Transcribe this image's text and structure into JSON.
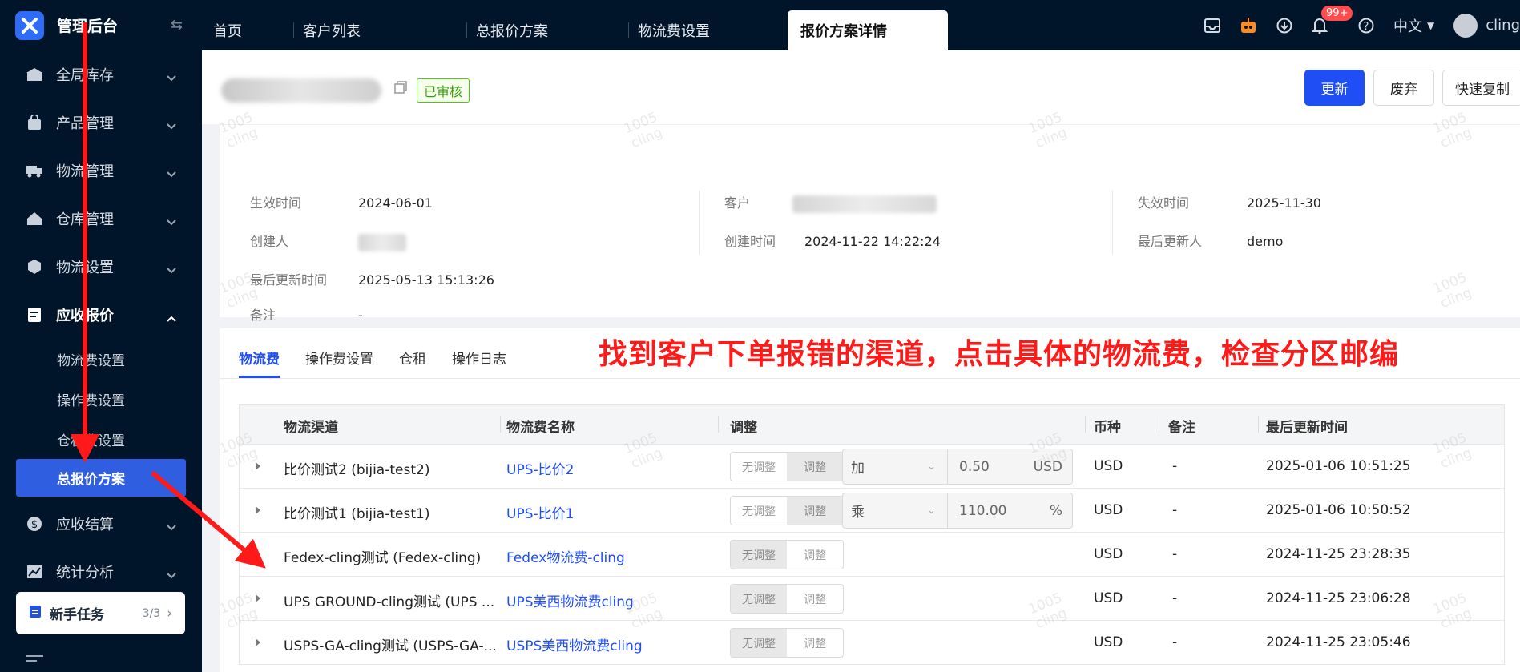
{
  "app": {
    "title": "管理后台"
  },
  "sidebar": {
    "items": [
      {
        "label": "全局库存",
        "icon": "warehouse-icon"
      },
      {
        "label": "产品管理",
        "icon": "bag-icon"
      },
      {
        "label": "物流管理",
        "icon": "truck-icon"
      },
      {
        "label": "仓库管理",
        "icon": "home-icon"
      },
      {
        "label": "物流设置",
        "icon": "box-gear-icon"
      },
      {
        "label": "应收报价",
        "icon": "document-icon"
      }
    ],
    "sub_items": [
      {
        "label": "物流费设置"
      },
      {
        "label": "操作费设置"
      },
      {
        "label": "仓租费设置"
      },
      {
        "label": "总报价方案"
      }
    ],
    "items_after": [
      {
        "label": "应收结算",
        "icon": "dollar-icon"
      },
      {
        "label": "统计分析",
        "icon": "chart-icon"
      }
    ],
    "tasks": {
      "label": "新手任务",
      "count": "3/3"
    }
  },
  "topbar": {
    "tabs": [
      "首页",
      "客户列表",
      "总报价方案",
      "物流费设置",
      "报价方案详情"
    ],
    "notification_count": "99+",
    "language": "中文",
    "user": "cling"
  },
  "header": {
    "status": "已审核",
    "buttons": {
      "update": "更新",
      "discard": "废弃",
      "quick_copy": "快速复制"
    }
  },
  "info": {
    "effective_time": {
      "label": "生效时间",
      "value": "2024-06-01"
    },
    "creator": {
      "label": "创建人"
    },
    "last_update_time": {
      "label": "最后更新时间",
      "value": "2025-05-13 15:13:26"
    },
    "remark": {
      "label": "备注",
      "value": "-"
    },
    "customer": {
      "label": "客户"
    },
    "create_time": {
      "label": "创建时间",
      "value": "2024-11-22 14:22:24"
    },
    "expire_time": {
      "label": "失效时间",
      "value": "2025-11-30"
    },
    "last_updater": {
      "label": "最后更新人",
      "value": "demo"
    }
  },
  "annotation": "找到客户下单报错的渠道，点击具体的物流费，检查分区邮编",
  "sub_tabs": [
    "物流费",
    "操作费设置",
    "仓租",
    "操作日志"
  ],
  "table": {
    "columns": [
      "物流渠道",
      "物流费名称",
      "调整",
      "币种",
      "备注",
      "最后更新时间"
    ],
    "adjust_labels": {
      "none": "无调整",
      "adjust": "调整"
    },
    "rows": [
      {
        "channel": "比价测试2 (bijia-test2)",
        "fee_name": "UPS-比价2",
        "op": "加",
        "amount": "0.50",
        "unit": "USD",
        "currency": "USD",
        "remark": "-",
        "updated": "2025-01-06 10:51:25"
      },
      {
        "channel": "比价测试1 (bijia-test1)",
        "fee_name": "UPS-比价1",
        "op": "乘",
        "amount": "110.00",
        "unit": "%",
        "currency": "USD",
        "remark": "-",
        "updated": "2025-01-06 10:50:52"
      },
      {
        "channel": "Fedex-cling测试 (Fedex-cling)",
        "fee_name": "Fedex物流费-cling",
        "currency": "USD",
        "remark": "-",
        "updated": "2024-11-25 23:28:35"
      },
      {
        "channel": "UPS GROUND-cling测试 (UPS ...",
        "fee_name": "UPS美西物流费cling",
        "currency": "USD",
        "remark": "-",
        "updated": "2024-11-25 23:06:28"
      },
      {
        "channel": "USPS-GA-cling测试 (USPS-GA-...",
        "fee_name": "USPS美西物流费cling",
        "currency": "USD",
        "remark": "-",
        "updated": "2024-11-25 23:05:46"
      }
    ]
  },
  "watermark": {
    "line1": "1005",
    "line2": "cling"
  },
  "colors": {
    "primary": "#1f4ef5",
    "sidebar_bg": "#001529",
    "annotation": "#ff1a1a",
    "success": "#52c41a"
  }
}
